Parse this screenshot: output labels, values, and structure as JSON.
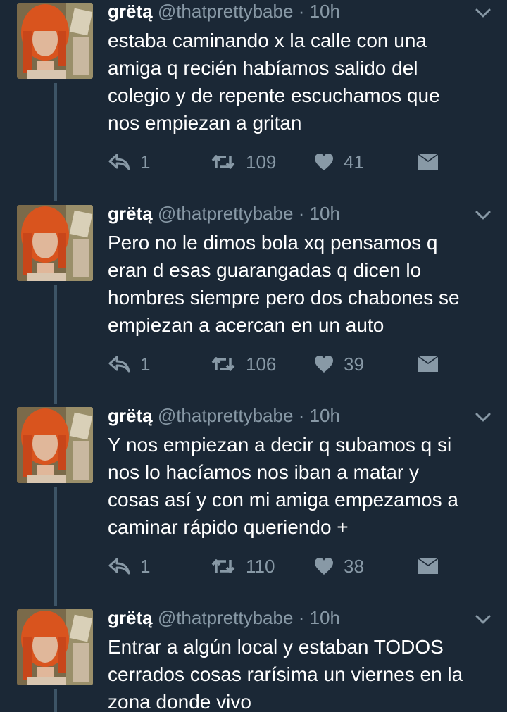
{
  "colors": {
    "background": "#1b2836",
    "text": "#ffffff",
    "secondary": "#8899a6",
    "thread_line": "#3d5466"
  },
  "tweets": [
    {
      "name": "grëtą",
      "handle": "@thatprettybabe",
      "dot": "·",
      "time": "10h",
      "lines": [
        "estaba caminando x la calle con una",
        "amiga q recién habíamos salido del",
        "colegio y de repente escuchamos que",
        "nos empiezan a gritan"
      ],
      "replies": "1",
      "retweets": "109",
      "likes": "41"
    },
    {
      "name": "grëtą",
      "handle": "@thatprettybabe",
      "dot": "·",
      "time": "10h",
      "lines": [
        "Pero no le dimos bola xq pensamos q",
        "eran d esas guarangadas q dicen lo",
        "hombres siempre pero dos chabones se",
        "empiezan a acercan en un auto"
      ],
      "replies": "1",
      "retweets": "106",
      "likes": "39"
    },
    {
      "name": "grëtą",
      "handle": "@thatprettybabe",
      "dot": "·",
      "time": "10h",
      "lines": [
        "Y nos empiezan a decir q subamos q si",
        "nos lo hacíamos nos iban a matar y",
        "cosas así y con mi amiga empezamos a",
        "caminar rápido queriendo +"
      ],
      "replies": "1",
      "retweets": "110",
      "likes": "38"
    },
    {
      "name": "grëtą",
      "handle": "@thatprettybabe",
      "dot": "·",
      "time": "10h",
      "lines": [
        "Entrar a algún local y estaban TODOS",
        "cerrados cosas rarísima un viernes en la",
        "zona donde vivo"
      ]
    }
  ]
}
